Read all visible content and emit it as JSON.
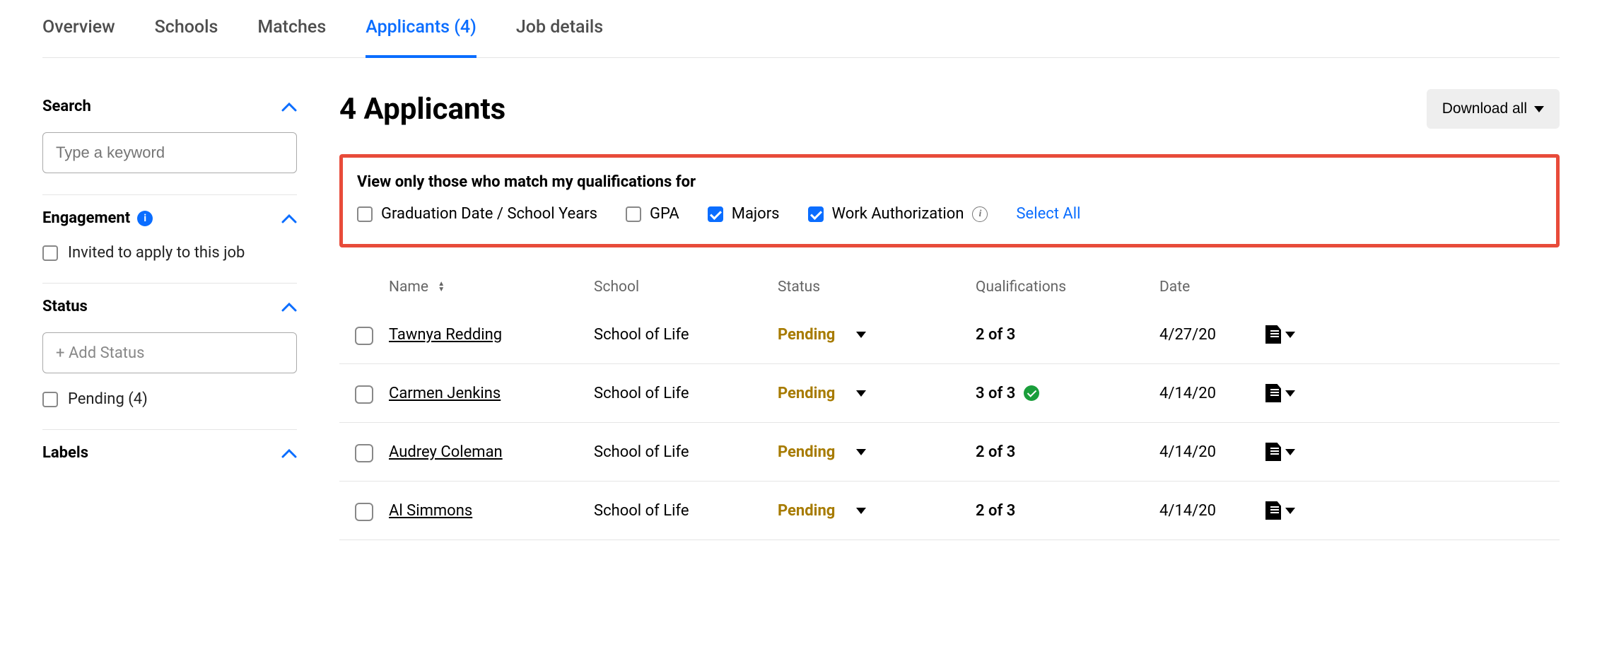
{
  "tabs": {
    "overview": "Overview",
    "schools": "Schools",
    "matches": "Matches",
    "applicants": "Applicants (4)",
    "job_details": "Job details"
  },
  "sidebar": {
    "search": {
      "title": "Search",
      "placeholder": "Type a keyword"
    },
    "engagement": {
      "title": "Engagement",
      "invited_label": "Invited to apply to this job"
    },
    "status": {
      "title": "Status",
      "add_placeholder": "+ Add Status",
      "pending_label": "Pending (4)"
    },
    "labels": {
      "title": "Labels"
    }
  },
  "main": {
    "title": "4 Applicants",
    "download_label": "Download all"
  },
  "filter": {
    "title": "View only those who match my qualifications for",
    "grad": "Graduation Date / School Years",
    "gpa": "GPA",
    "majors": "Majors",
    "work_auth": "Work Authorization",
    "select_all": "Select All"
  },
  "columns": {
    "name": "Name",
    "school": "School",
    "status": "Status",
    "qual": "Qualifications",
    "date": "Date"
  },
  "rows": [
    {
      "name": "Tawnya Redding",
      "school": "School of Life",
      "status": "Pending",
      "qual": "2 of 3",
      "full": false,
      "date": "4/27/20"
    },
    {
      "name": "Carmen Jenkins",
      "school": "School of Life",
      "status": "Pending",
      "qual": "3 of 3",
      "full": true,
      "date": "4/14/20"
    },
    {
      "name": "Audrey Coleman",
      "school": "School of Life",
      "status": "Pending",
      "qual": "2 of 3",
      "full": false,
      "date": "4/14/20"
    },
    {
      "name": "Al Simmons",
      "school": "School of Life",
      "status": "Pending",
      "qual": "2 of 3",
      "full": false,
      "date": "4/14/20"
    }
  ]
}
